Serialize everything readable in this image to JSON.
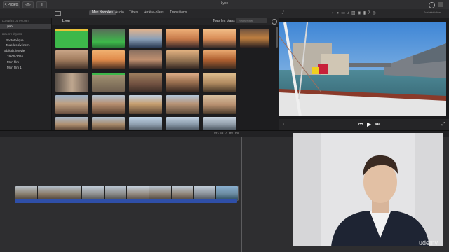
{
  "window": {
    "title": "Lyon",
    "projects_label": "< Projets",
    "back_label": "◁▷"
  },
  "toolbar": {
    "tabs": [
      "Mes données",
      "Audio",
      "Titres",
      "Arrière-plans",
      "Transitions"
    ],
    "active_tab_index": 0
  },
  "sidebar": {
    "project_section": "DONNÉES DU PROJET",
    "project_item": "Lyon",
    "libraries_section": "BIBLIOTHÈQUES",
    "items": [
      "Photothèque",
      "Tous les événem."
    ],
    "library": "Biblioth. iMovie",
    "events": [
      "19-05-2016",
      "Mon film",
      "Mon film 1"
    ]
  },
  "browser": {
    "project_name": "Lyon",
    "filter_label": "Tous les plans",
    "search_placeholder": "Rechercher"
  },
  "viewer": {
    "right_label": "Tout réinitialiser"
  },
  "timeline": {
    "timecode": "00:35 / 00:06"
  },
  "colors": {
    "accent_blue": "#2f4fa8",
    "green_clip": "#3db84a",
    "selection_yellow": "#e8c23a"
  },
  "watermark": "udemy"
}
